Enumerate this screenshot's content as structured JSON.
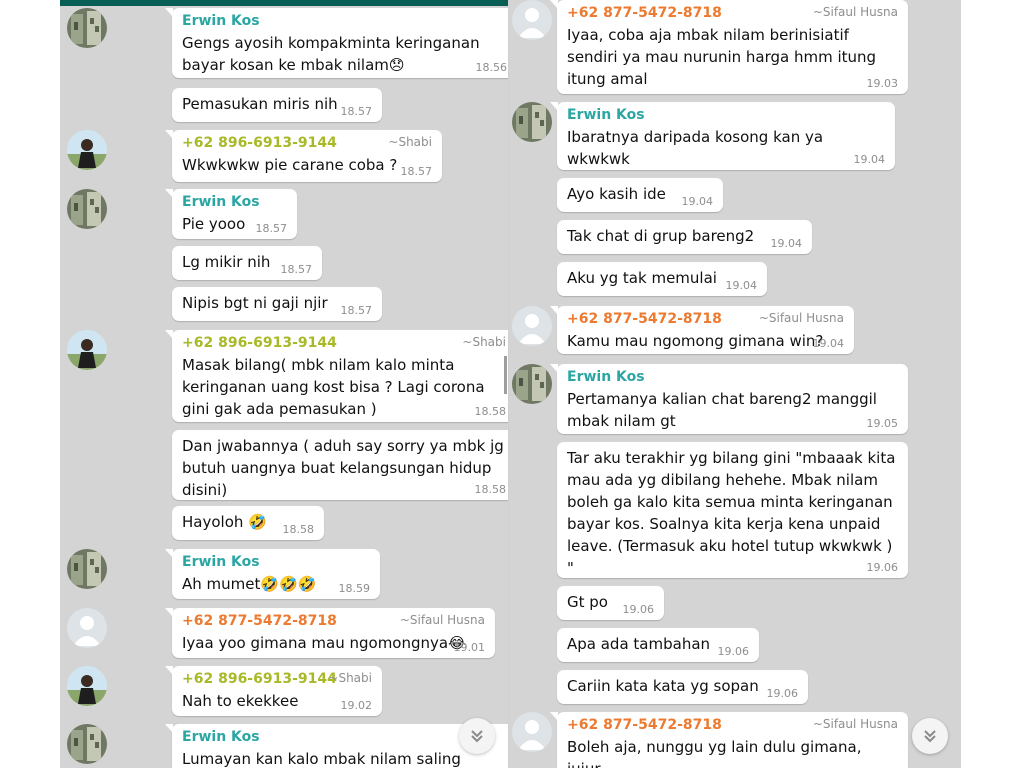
{
  "colors": {
    "background": "#d4d4d4",
    "bubble": "#ffffff",
    "sender_erwin": "#2aa6a3",
    "sender_shabi": "#a8b928",
    "sender_sifaul": "#ec7a30",
    "time": "#8e8e8e",
    "header_bar": "#075e54"
  },
  "left": {
    "messages": [
      {
        "sender": "Erwin Kos",
        "sender_color": "#2aa6a3",
        "text": "Gengs ayosih kompakminta keringanan bayar kosan ke mbak nilam😞",
        "time": "18.56",
        "avatar": "photo"
      },
      {
        "text": "Pemasukan miris nih",
        "time": "18.57"
      },
      {
        "sender": "+62 896-6913-9144",
        "sender_color": "#a8b928",
        "push_name": "~Shabi",
        "text": "Wkwkwkw pie carane coba ?",
        "time": "18.57",
        "avatar": "person"
      },
      {
        "sender": "Erwin Kos",
        "sender_color": "#2aa6a3",
        "text": "Pie yooo",
        "time": "18.57",
        "avatar": "photo"
      },
      {
        "text": "Lg mikir nih",
        "time": "18.57"
      },
      {
        "text": "Nipis bgt ni gaji njir",
        "time": "18.57"
      },
      {
        "sender": "+62 896-6913-9144",
        "sender_color": "#a8b928",
        "push_name": "~Shabi",
        "text": "Masak bilang( mbk nilam kalo minta keringanan uang kost bisa ? Lagi corona gini gak ada pemasukan )",
        "time": "18.58",
        "avatar": "person"
      },
      {
        "text": "Dan jwabannya ( aduh say sorry ya mbk jg butuh uangnya buat kelangsungan hidup disini)",
        "time": "18.58"
      },
      {
        "text": "Hayoloh 🤣",
        "time": "18.58"
      },
      {
        "sender": "Erwin Kos",
        "sender_color": "#2aa6a3",
        "text": "Ah mumet🤣🤣🤣",
        "time": "18.59",
        "avatar": "photo"
      },
      {
        "sender": "+62 877-5472-8718",
        "sender_color": "#ec7a30",
        "push_name": "~Sifaul Husna",
        "text": "Iyaa yoo gimana mau ngomongnya😂",
        "time": "19.01",
        "avatar": "default"
      },
      {
        "sender": "+62 896-6913-9144",
        "sender_color": "#a8b928",
        "push_name": "~Shabi",
        "text": "Nah to ekekkee",
        "time": "19.02",
        "avatar": "person"
      },
      {
        "sender": "Erwin Kos",
        "sender_color": "#2aa6a3",
        "text": "Lumayan kan kalo mbak nilam saling",
        "time": "",
        "avatar": "photo"
      }
    ]
  },
  "right": {
    "messages": [
      {
        "sender": "+62 877-5472-8718",
        "sender_color": "#ec7a30",
        "push_name": "~Sifaul Husna",
        "text": "Iyaa, coba aja mbak nilam berinisiatif sendiri ya mau nurunin harga hmm itung itung amal",
        "time": "19.03",
        "avatar": "default"
      },
      {
        "sender": "Erwin Kos",
        "sender_color": "#2aa6a3",
        "text": "Ibaratnya daripada kosong kan ya wkwkwk",
        "time": "19.04",
        "avatar": "photo"
      },
      {
        "text": "Ayo kasih ide",
        "time": "19.04"
      },
      {
        "text": "Tak chat di grup bareng2",
        "time": "19.04"
      },
      {
        "text": "Aku yg tak memulai",
        "time": "19.04"
      },
      {
        "sender": "+62 877-5472-8718",
        "sender_color": "#ec7a30",
        "push_name": "~Sifaul Husna",
        "text": "Kamu mau ngomong gimana win?",
        "time": "19.04",
        "avatar": "default"
      },
      {
        "sender": "Erwin Kos",
        "sender_color": "#2aa6a3",
        "text": "Pertamanya kalian chat bareng2 manggil mbak nilam gt",
        "time": "19.05",
        "avatar": "photo"
      },
      {
        "text": "Tar aku terakhir yg bilang gini \"mbaaak kita mau ada yg dibilang hehehe. Mbak nilam boleh ga kalo kita semua minta keringanan bayar kos. Soalnya kita kerja kena unpaid leave. (Termasuk aku hotel tutup wkwkwk )\n\"",
        "time": "19.06"
      },
      {
        "text": "Gt po",
        "time": "19.06"
      },
      {
        "text": "Apa ada tambahan",
        "time": "19.06"
      },
      {
        "text": "Cariin kata kata yg sopan",
        "time": "19.06"
      },
      {
        "sender": "+62 877-5472-8718",
        "sender_color": "#ec7a30",
        "push_name": "~Sifaul Husna",
        "text": "Boleh aja, nunggu yg lain dulu gimana, jujur",
        "time": "",
        "avatar": "default"
      }
    ]
  }
}
